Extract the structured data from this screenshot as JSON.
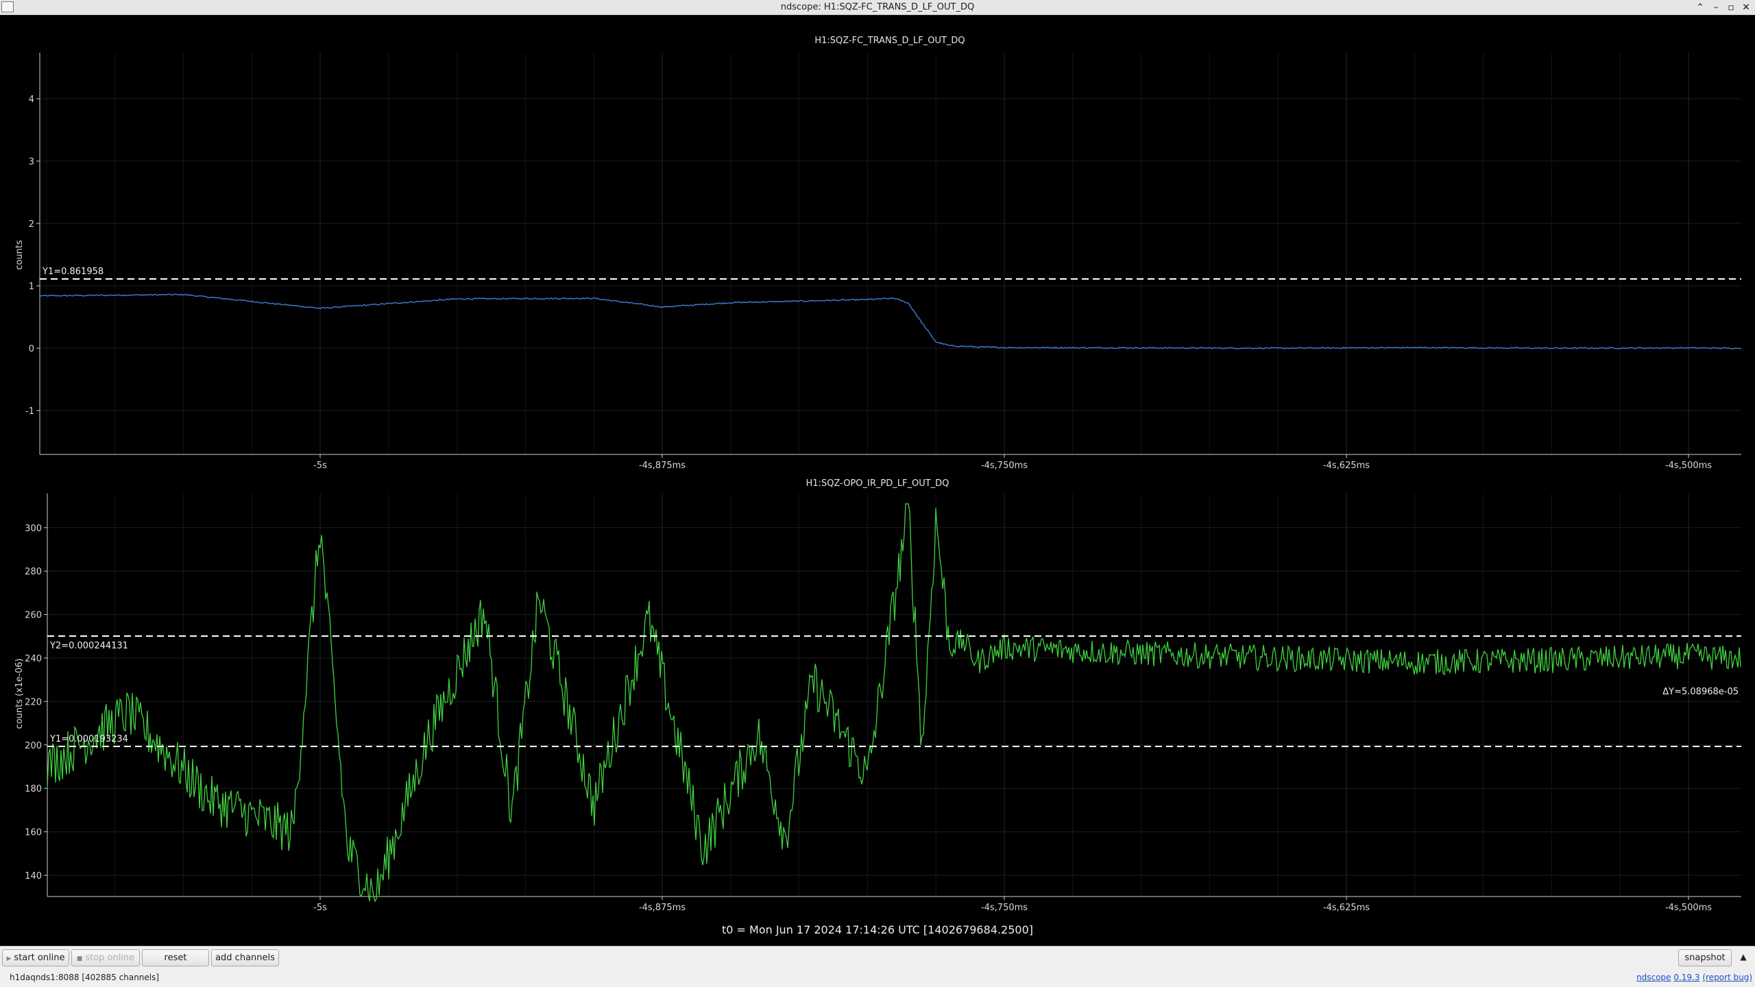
{
  "window": {
    "title": "ndscope: H1:SQZ-FC_TRANS_D_LF_OUT_DQ"
  },
  "plot1": {
    "title": "H1:SQZ-FC_TRANS_D_LF_OUT_DQ",
    "ylabel": "counts",
    "yticks": [
      "4",
      "3",
      "2",
      "1",
      "0",
      "-1"
    ],
    "xticks": [
      "-5s",
      "-4s,875ms",
      "-4s,750ms",
      "-4s,625ms",
      "-4s,500ms"
    ],
    "cursor_y1": "Y1=0.861958",
    "line_color": "#3a78c9"
  },
  "plot2": {
    "title": "H1:SQZ-OPO_IR_PD_LF_OUT_DQ",
    "ylabel": "counts (x1e-06)",
    "yticks": [
      "300",
      "280",
      "260",
      "240",
      "220",
      "200",
      "180",
      "160",
      "140"
    ],
    "xticks": [
      "-5s",
      "-4s,875ms",
      "-4s,750ms",
      "-4s,625ms",
      "-4s,500ms"
    ],
    "cursor_y2": "Y2=0.000244131",
    "cursor_y1": "Y1=0.000193234",
    "cursor_dy": "ΔY=5.08968e-05",
    "line_color": "#3fd23f"
  },
  "t0_label": "t0 = Mon Jun 17 2024 17:14:26 UTC [1402679684.2500]",
  "toolbar": {
    "start_online": "start online",
    "stop_online": "stop online",
    "reset": "reset",
    "add_channels": "add channels",
    "snapshot": "snapshot"
  },
  "status": {
    "server": "h1daqnds1:8088  [402885 channels]",
    "app_name": "ndscope",
    "version": "0.19.3",
    "report_bug": "(report bug)"
  },
  "chart_data": [
    {
      "type": "line",
      "title": "H1:SQZ-FC_TRANS_D_LF_OUT_DQ",
      "xlabel": "",
      "ylabel": "counts",
      "x_ticks": [
        "-5s",
        "-4s,875ms",
        "-4s,750ms",
        "-4s,625ms",
        "-4s,500ms"
      ],
      "x_seconds": [
        -5.1,
        -5.05,
        -5.0,
        -4.95,
        -4.9,
        -4.875,
        -4.85,
        -4.8,
        -4.79,
        -4.785,
        -4.78,
        -4.775,
        -4.77,
        -4.76,
        -4.75,
        -4.7,
        -4.65,
        -4.6,
        -4.55,
        -4.5,
        -4.488
      ],
      "series": [
        {
          "values": [
            0.84,
            0.86,
            0.64,
            0.79,
            0.8,
            0.66,
            0.73,
            0.78,
            0.8,
            0.72,
            0.4,
            0.1,
            0.04,
            0.02,
            0.01,
            0.005,
            0.0,
            0.01,
            0.0,
            0.005,
            0.0
          ]
        }
      ],
      "ylim": [
        -1.95,
        4.5
      ],
      "cursor_y": 0.861958,
      "grid": true
    },
    {
      "type": "line",
      "title": "H1:SQZ-OPO_IR_PD_LF_OUT_DQ",
      "xlabel": "",
      "ylabel": "counts (x1e-06)",
      "x_ticks": [
        "-5s",
        "-4s,875ms",
        "-4s,750ms",
        "-4s,625ms",
        "-4s,500ms"
      ],
      "x_seconds": [
        -5.1,
        -5.07,
        -5.04,
        -5.01,
        -5.0,
        -4.99,
        -4.98,
        -4.96,
        -4.94,
        -4.93,
        -4.92,
        -4.9,
        -4.88,
        -4.86,
        -4.84,
        -4.83,
        -4.82,
        -4.8,
        -4.785,
        -4.78,
        -4.775,
        -4.77,
        -4.765,
        -4.76,
        -4.75,
        -4.7,
        -4.65,
        -4.6,
        -4.55,
        -4.5,
        -4.488
      ],
      "series": [
        {
          "values": [
            190,
            215,
            175,
            160,
            300,
            152,
            130,
            205,
            262,
            168,
            268,
            172,
            258,
            152,
            205,
            157,
            230,
            185,
            310,
            198,
            305,
            245,
            248,
            238,
            245,
            242,
            240,
            238,
            239,
            241,
            240
          ]
        }
      ],
      "ylim": [
        125,
        312
      ],
      "cursor_y1": 193.234,
      "cursor_y2": 244.131,
      "grid": true
    }
  ]
}
